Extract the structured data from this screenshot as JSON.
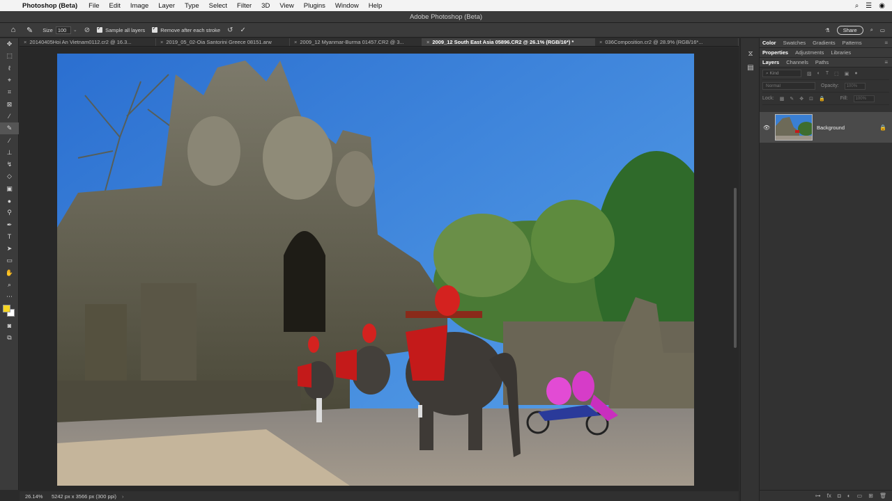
{
  "menubar": {
    "app": "Photoshop (Beta)",
    "items": [
      "File",
      "Edit",
      "Image",
      "Layer",
      "Type",
      "Select",
      "Filter",
      "3D",
      "View",
      "Plugins",
      "Window",
      "Help"
    ]
  },
  "window": {
    "title": "Adobe Photoshop (Beta)"
  },
  "options": {
    "size_label": "Size",
    "size_value": "100",
    "sample_all_layers": "Sample all layers",
    "remove_after_stroke": "Remove after each stroke",
    "share": "Share"
  },
  "tabs": [
    "20140405Hoi An Vietnam0112.cr2 @ 16.3...",
    "2019_05_02-Oia Santorini Greece 08151.arw",
    "2009_12 Myanmar-Burma 01457.CR2 @ 3...",
    "2009_12 South East Asia 05896.CR2 @ 26.1% (RGB/16*) *",
    "036Composition.cr2 @ 28.9% (RGB/16*..."
  ],
  "active_tab": 3,
  "status": {
    "zoom": "26.14%",
    "dimensions": "5242 px x 3566 px (300 ppi)"
  },
  "panels": {
    "row1": [
      "Color",
      "Swatches",
      "Gradients",
      "Patterns"
    ],
    "row2": [
      "Properties",
      "Adjustments",
      "Libraries"
    ],
    "row3": [
      "Layers",
      "Channels",
      "Paths"
    ],
    "kind_placeholder": "Kind",
    "blend_mode": "Normal",
    "opacity_label": "Opacity:",
    "opacity_value": "100%",
    "lock_label": "Lock:",
    "fill_label": "Fill:",
    "fill_value": "100%",
    "layer_name": "Background"
  },
  "colors": {
    "foreground": "#f6d622",
    "background": "#ffffff"
  }
}
